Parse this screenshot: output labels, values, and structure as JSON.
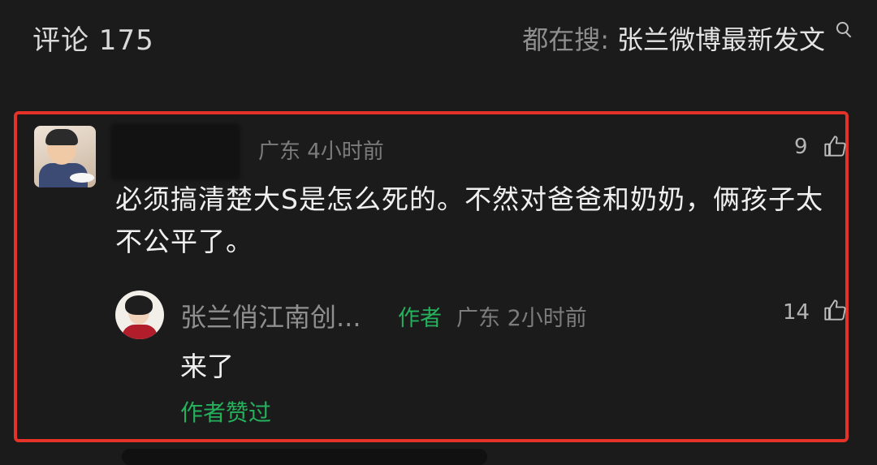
{
  "header": {
    "comment_count_label": "评论 175",
    "search_prefix": "都在搜:",
    "search_query": "张兰微博最新发文"
  },
  "comment": {
    "location_time": "广东 4小时前",
    "like_count": "9",
    "text": "必须搞清楚大S是怎么死的。不然对爸爸和奶奶，俩孩子太不公平了。"
  },
  "reply": {
    "author_name": "张兰俏江南创...",
    "author_tag": "作者",
    "location_time": "广东 2小时前",
    "like_count": "14",
    "text": "来了",
    "liked_by_author": "作者赞过"
  },
  "colors": {
    "background": "#1b1b1b",
    "highlight_border": "#e53228",
    "author_green": "#25b05c"
  }
}
